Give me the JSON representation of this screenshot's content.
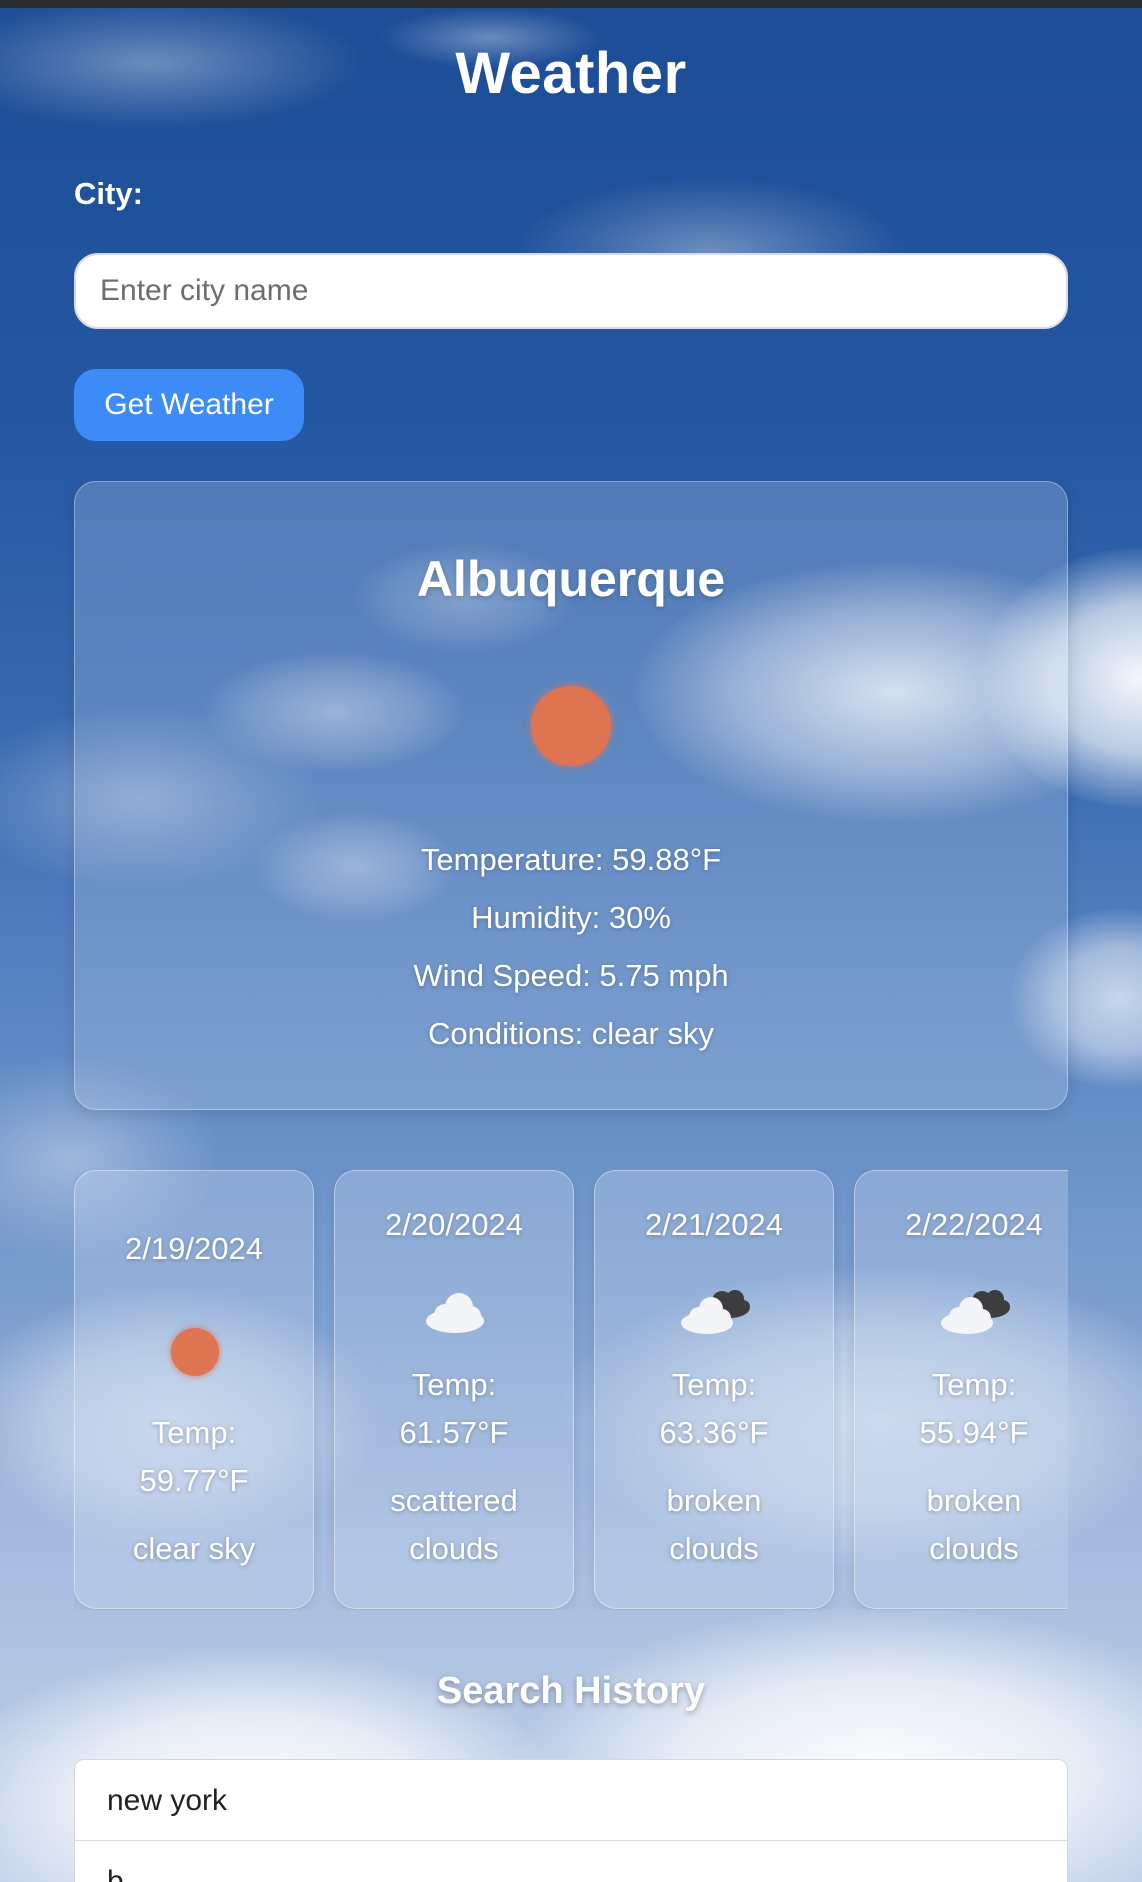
{
  "app": {
    "title": "Weather"
  },
  "search": {
    "label": "City:",
    "placeholder": "Enter city name",
    "value": "",
    "button_label": "Get Weather"
  },
  "current": {
    "city": "Albuquerque",
    "icon": "sun-icon",
    "temperature": "Temperature: 59.88°F",
    "humidity": "Humidity: 30%",
    "wind": "Wind Speed: 5.75 mph",
    "conditions": "Conditions: clear sky"
  },
  "forecast": [
    {
      "date": "2/19/2024",
      "icon": "sun-icon",
      "temp_label": "Temp:",
      "temp": "59.77°F",
      "desc1": "clear sky",
      "desc2": ""
    },
    {
      "date": "2/20/2024",
      "icon": "cloud-icon",
      "temp_label": "Temp:",
      "temp": "61.57°F",
      "desc1": "scattered",
      "desc2": "clouds"
    },
    {
      "date": "2/21/2024",
      "icon": "broken-clouds-icon",
      "temp_label": "Temp:",
      "temp": "63.36°F",
      "desc1": "broken",
      "desc2": "clouds"
    },
    {
      "date": "2/22/2024",
      "icon": "broken-clouds-icon",
      "temp_label": "Temp:",
      "temp": "55.94°F",
      "desc1": "broken",
      "desc2": "clouds"
    }
  ],
  "history": {
    "title": "Search History",
    "items": [
      "new york",
      "b"
    ]
  },
  "colors": {
    "accent_button": "#3d8bf7",
    "sun": "#df7453",
    "sky_top": "#1d4d97"
  }
}
